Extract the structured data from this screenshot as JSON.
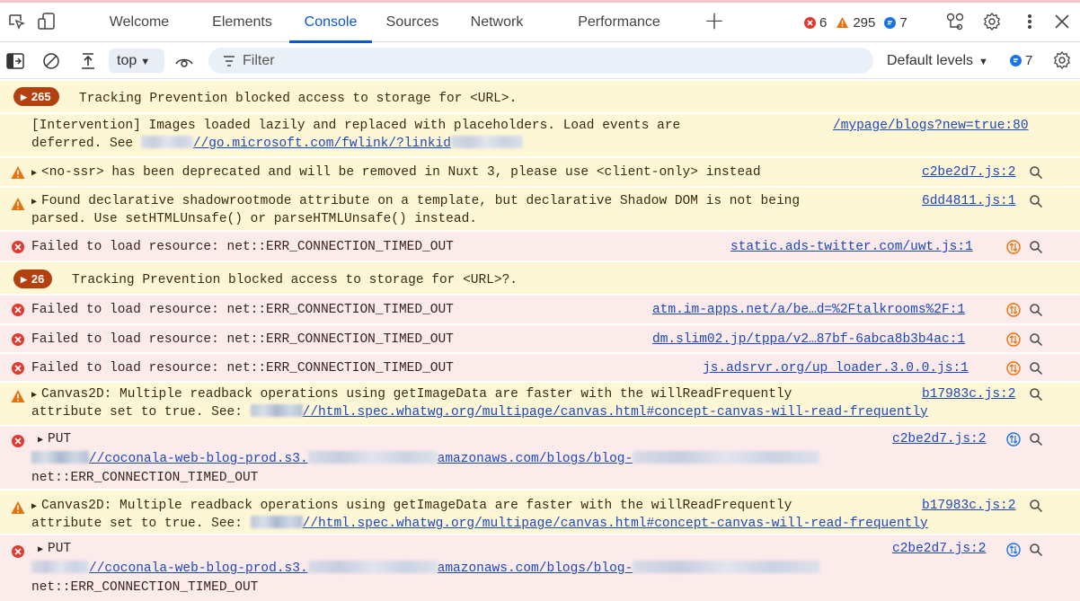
{
  "tabs": [
    "Welcome",
    "Elements",
    "Console",
    "Sources",
    "Network",
    "Performance"
  ],
  "active_tab": "Console",
  "counts": {
    "errors": "6",
    "warnings": "295",
    "info": "7"
  },
  "toolbar": {
    "context": "top",
    "filter_placeholder": "Filter",
    "levels": "Default levels",
    "info_count": "7"
  },
  "colors": {
    "accent": "#0b57d0",
    "error": "#e0392f",
    "warning": "#e8710a",
    "info": "#1a73e8",
    "badge": "#b3410f"
  },
  "messages": [
    {
      "level": "group",
      "count": "265",
      "text": "Tracking Prevention blocked access to storage for <URL>."
    },
    {
      "level": "info",
      "line1": "[Intervention] Images loaded lazily and replaced with placeholders. Load events are",
      "line2_prefix": "deferred. See ",
      "link": "//go.microsoft.com/fwlink/?linkid",
      "source": "/mypage/blogs?new=true:80"
    },
    {
      "level": "warning",
      "text": "<no-ssr> has been deprecated and will be removed in Nuxt 3, please use <client-only> instead",
      "source": "c2be2d7.js:2"
    },
    {
      "level": "warning",
      "line1": "Found declarative shadowrootmode attribute on a template, but declarative Shadow DOM is not being",
      "line2": "parsed. Use setHTMLUnsafe() or parseHTMLUnsafe() instead.",
      "source": "6dd4811.js:1"
    },
    {
      "level": "error",
      "text": "Failed to load resource: net::ERR_CONNECTION_TIMED_OUT",
      "source": "static.ads-twitter.com/uwt.js:1"
    },
    {
      "level": "group",
      "count": "26",
      "text": "Tracking Prevention blocked access to storage for <URL>?."
    },
    {
      "level": "error",
      "text": "Failed to load resource: net::ERR_CONNECTION_TIMED_OUT",
      "source": "atm.im-apps.net/a/be…d=%2Ftalkrooms%2F:1"
    },
    {
      "level": "error",
      "text": "Failed to load resource: net::ERR_CONNECTION_TIMED_OUT",
      "source": "dm.slim02.jp/tppa/v2…87bf-6abca8b3b4ac:1"
    },
    {
      "level": "error",
      "text": "Failed to load resource: net::ERR_CONNECTION_TIMED_OUT",
      "source": "js.adsrvr.org/up_loader.3.0.0.js:1"
    },
    {
      "level": "warning",
      "line1": "Canvas2D: Multiple readback operations using getImageData are faster with the willReadFrequently",
      "line2_prefix": "attribute set to true. See: ",
      "link": "//html.spec.whatwg.org/multipage/canvas.html#concept-canvas-will-read-frequently",
      "source": "b17983c.js:2"
    },
    {
      "level": "error",
      "line1": "PUT",
      "link_a": "//coconala-web-blog-prod.s3.",
      "link_b": "amazonaws.com/blogs/blog-",
      "line3": "net::ERR_CONNECTION_TIMED_OUT",
      "source": "c2be2d7.js:2"
    },
    {
      "level": "warning",
      "line1": "Canvas2D: Multiple readback operations using getImageData are faster with the willReadFrequently",
      "line2_prefix": "attribute set to true. See: ",
      "link": "//html.spec.whatwg.org/multipage/canvas.html#concept-canvas-will-read-frequently",
      "source": "b17983c.js:2"
    },
    {
      "level": "error",
      "line1": "PUT",
      "link_a": "//coconala-web-blog-prod.s3.",
      "link_b": "amazonaws.com/blogs/blog-",
      "line3": "net::ERR_CONNECTION_TIMED_OUT",
      "source": "c2be2d7.js:2"
    }
  ]
}
